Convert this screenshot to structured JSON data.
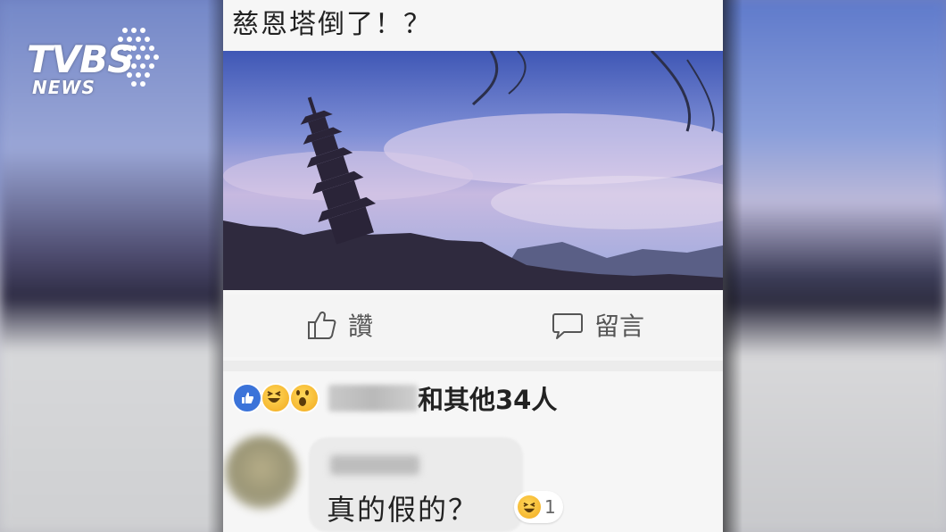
{
  "post": {
    "title": "慈恩塔倒了！？"
  },
  "actions": {
    "like_label": "讚",
    "comment_label": "留言"
  },
  "reactions": {
    "others_text": "和其他34人",
    "icons": [
      "like-icon",
      "haha-icon",
      "wow-icon"
    ]
  },
  "comment": {
    "text": "真的假的？",
    "reaction_icon": "haha-icon",
    "reaction_count": "1"
  },
  "watermark": {
    "brand": "TVBS",
    "sub": "NEWS"
  },
  "colors": {
    "like_blue": "#3b73d9",
    "emoji_yellow": "#f5b52d"
  }
}
